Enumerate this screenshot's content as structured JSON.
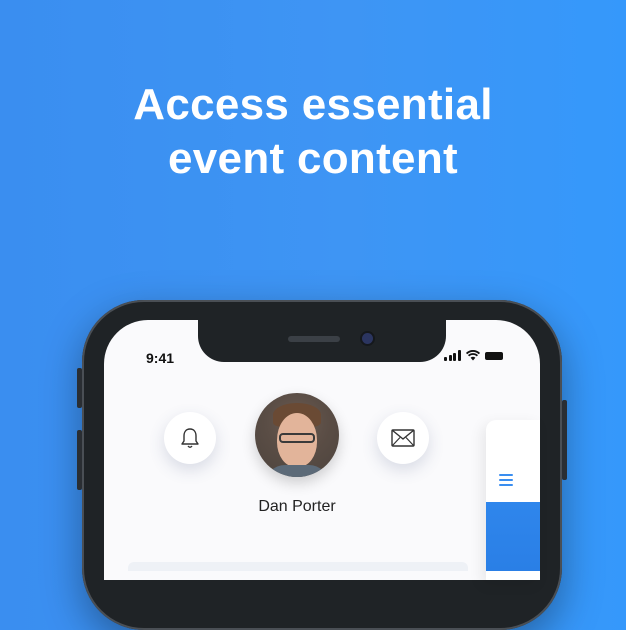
{
  "hero": {
    "title_line1": "Access essential",
    "title_line2": "event content"
  },
  "status_bar": {
    "time": "9:41",
    "icons": [
      "signal-icon",
      "wifi-icon",
      "battery-icon"
    ]
  },
  "profile": {
    "name": "Dan Porter",
    "avatar": "avatar-photo"
  },
  "actions": {
    "notifications_icon": "bell-icon",
    "messages_icon": "mail-icon",
    "menu_icon": "menu-icon"
  },
  "colors": {
    "background": "#3a8ef0",
    "accent": "#3a8ef0",
    "screen": "#fafafc",
    "phone_frame": "#1f2326"
  }
}
